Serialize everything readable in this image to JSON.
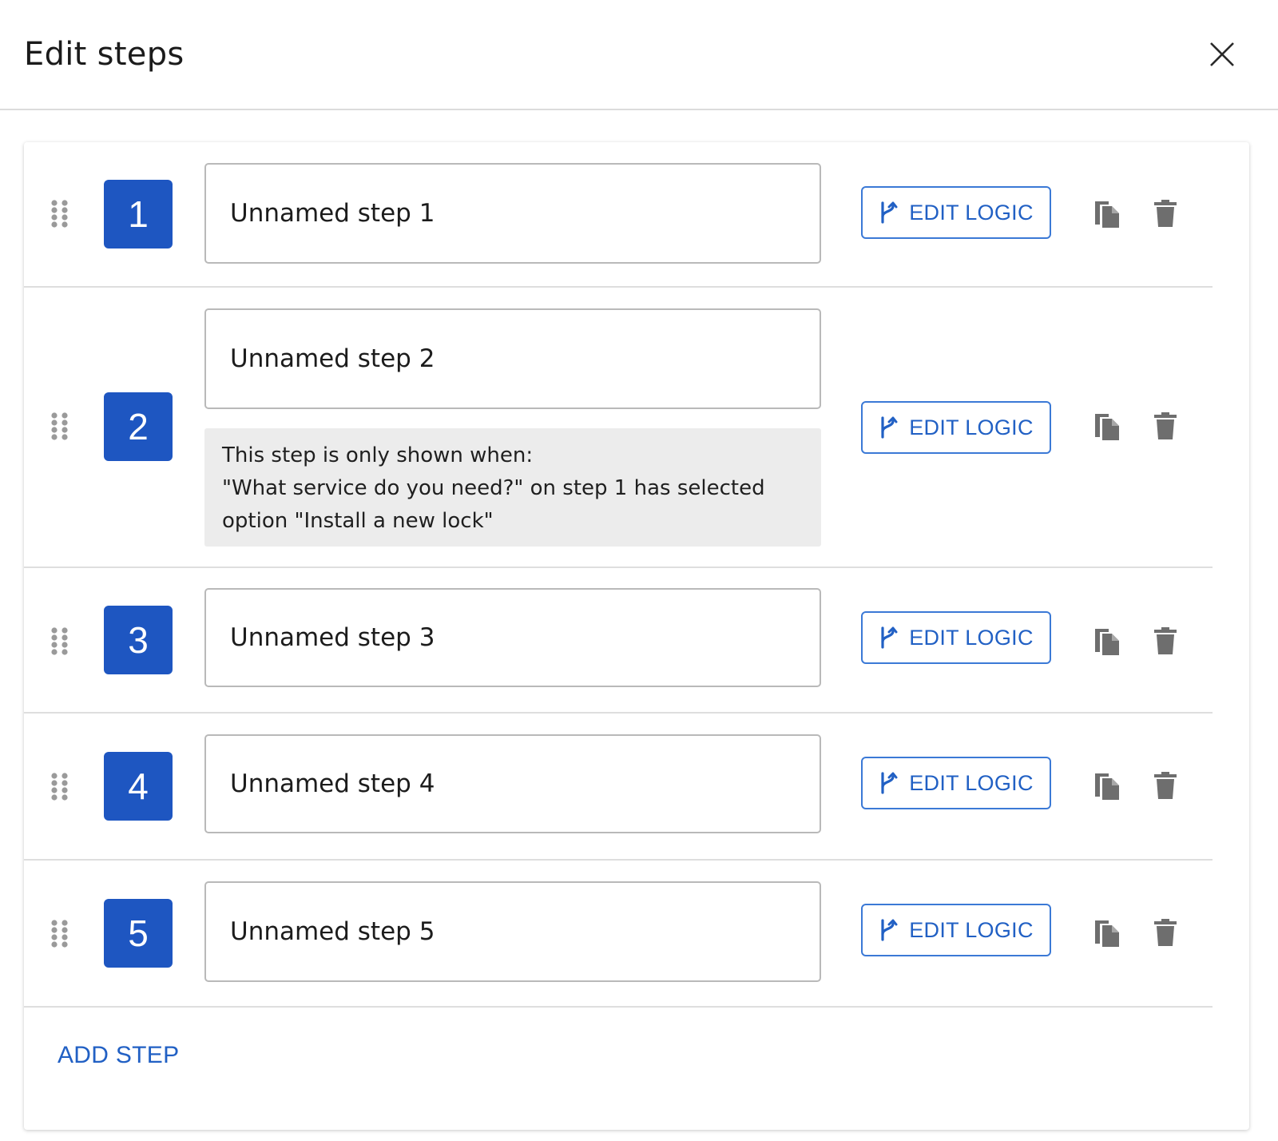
{
  "dialog": {
    "title": "Edit steps"
  },
  "steps": [
    {
      "number": "1",
      "name": "Unnamed step 1",
      "edit_logic_label": "EDIT LOGIC"
    },
    {
      "number": "2",
      "name": "Unnamed step 2",
      "edit_logic_label": "EDIT LOGIC",
      "condition": {
        "line1": "This step is only shown when:",
        "line2": "\"What service do you need?\" on step 1 has selected",
        "line3": "option \"Install a new lock\""
      }
    },
    {
      "number": "3",
      "name": "Unnamed step 3",
      "edit_logic_label": "EDIT LOGIC"
    },
    {
      "number": "4",
      "name": "Unnamed step 4",
      "edit_logic_label": "EDIT LOGIC"
    },
    {
      "number": "5",
      "name": "Unnamed step 5",
      "edit_logic_label": "EDIT LOGIC"
    }
  ],
  "footer": {
    "add_step_label": "ADD STEP"
  },
  "colors": {
    "badge": "#1e56c1",
    "accent": "#2160c4",
    "note_bg": "#ececec"
  },
  "icons": {
    "close": "close-icon",
    "drag": "drag-handle-icon",
    "logic": "branch-icon",
    "copy": "copy-icon",
    "delete": "trash-icon"
  }
}
